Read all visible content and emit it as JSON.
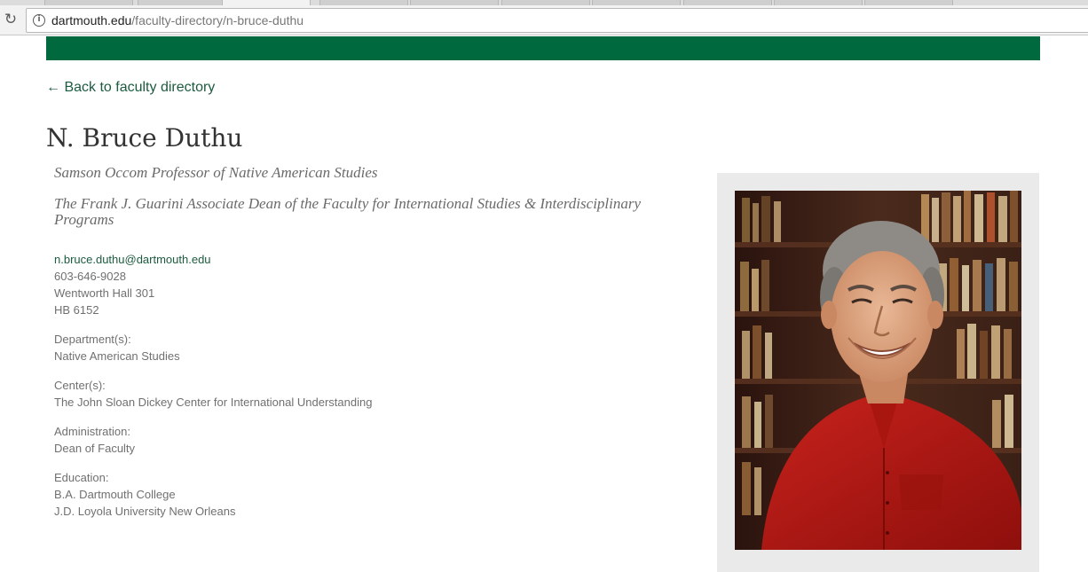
{
  "browser": {
    "url_host": "dartmouth.edu",
    "url_path": "/faculty-directory/n-bruce-duthu"
  },
  "page": {
    "back_link": "← Back to faculty directory",
    "name": "N. Bruce Duthu",
    "titles": [
      "Samson Occom Professor of Native American Studies",
      "The Frank J. Guarini Associate Dean of the Faculty for International Studies & Interdisciplinary Programs"
    ],
    "contact": {
      "email": "n.bruce.duthu@dartmouth.edu",
      "phone": "603-646-9028",
      "office": "Wentworth Hall 301",
      "mail_code": "HB 6152"
    },
    "sections": [
      {
        "label": "Department(s):",
        "values": [
          "Native American Studies"
        ]
      },
      {
        "label": "Center(s):",
        "values": [
          "The John Sloan Dickey Center for International Understanding"
        ]
      },
      {
        "label": "Administration:",
        "values": [
          "Dean of Faculty"
        ]
      },
      {
        "label": "Education:",
        "values": [
          "B.A. Dartmouth College",
          "J.D. Loyola University New Orleans"
        ]
      }
    ]
  },
  "colors": {
    "brand_green": "#00693e",
    "link_green": "#1c5b3f"
  },
  "icons": {
    "reload": "reload-icon",
    "info": "info-icon"
  }
}
